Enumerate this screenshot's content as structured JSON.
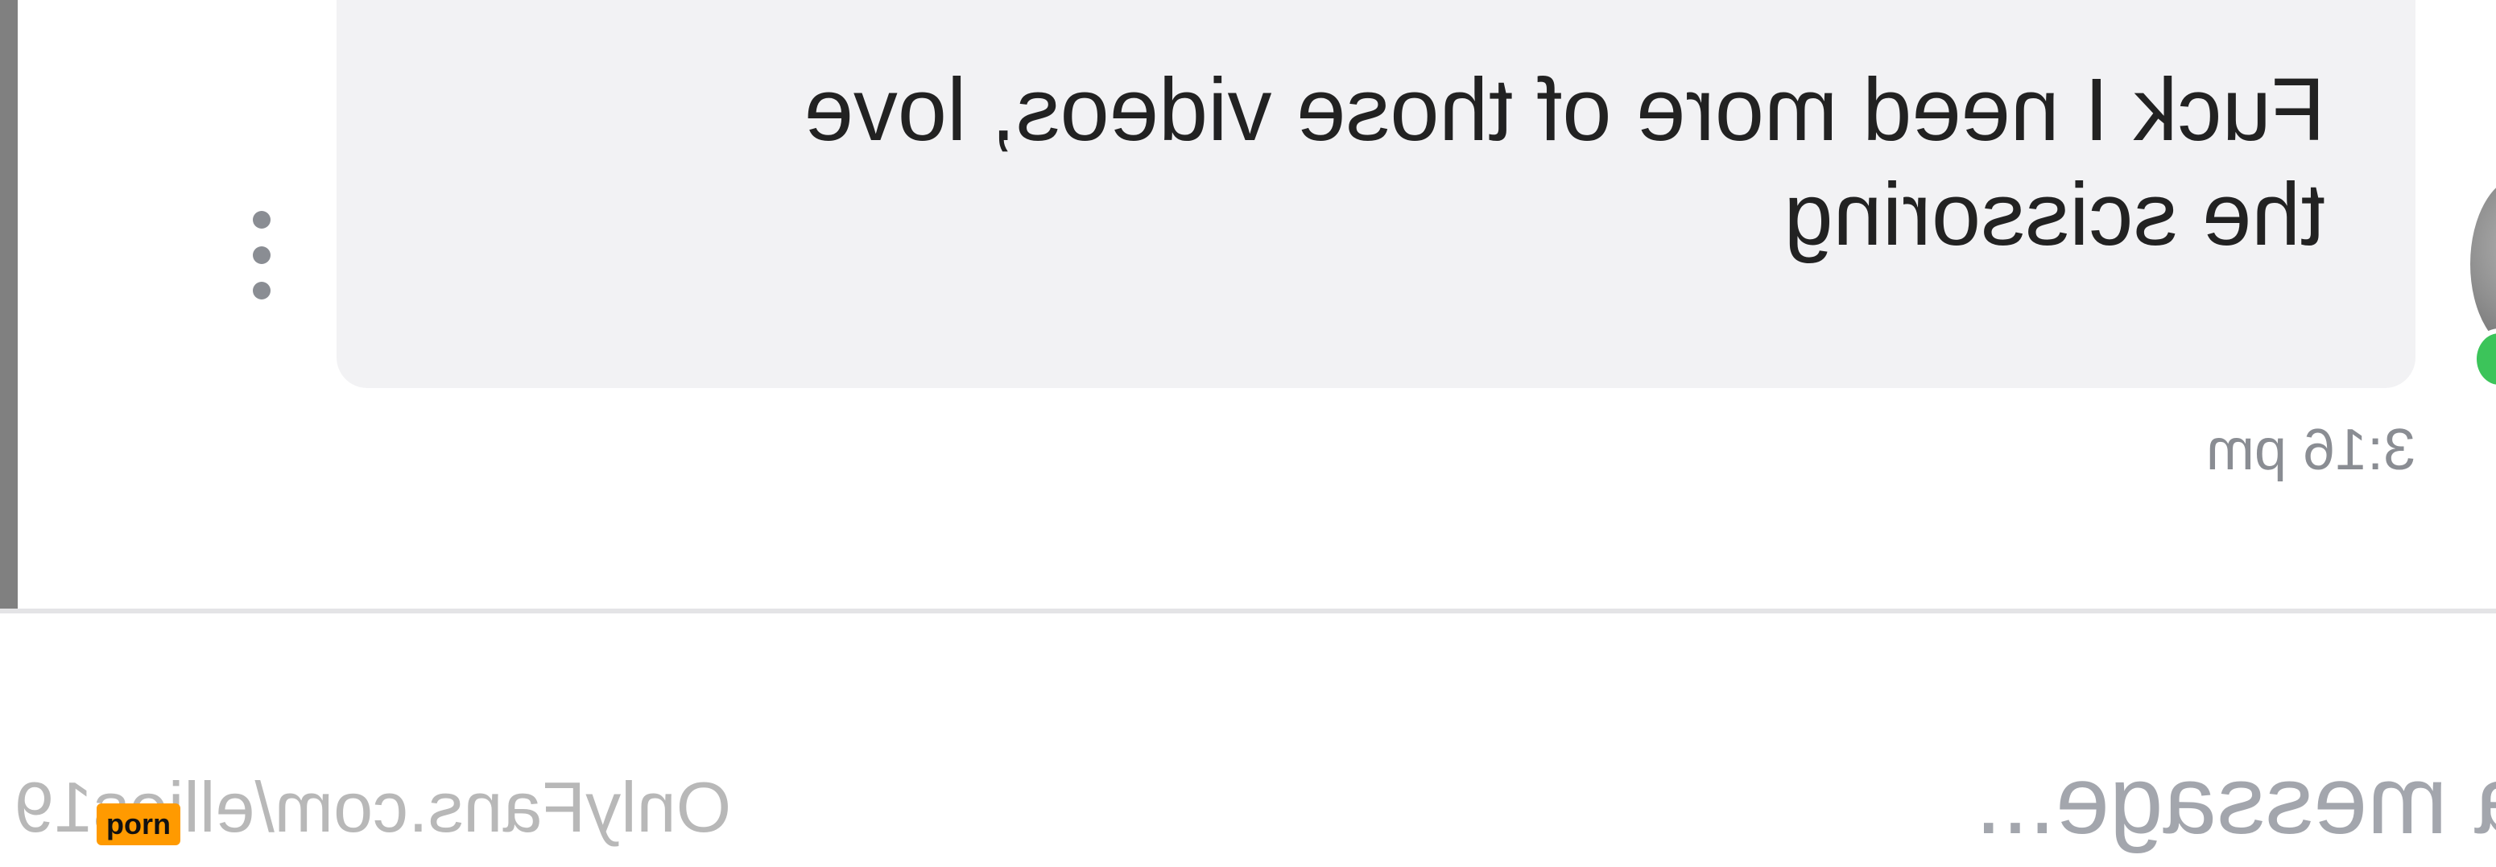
{
  "message": {
    "line1": "Fuck I need more of those videos, love",
    "line2": "the scissoring",
    "timestamp": "3:16 pm"
  },
  "composer": {
    "placeholder": "a message..."
  },
  "watermark": {
    "text": "OnlyFans.com/ellies19"
  },
  "badge": {
    "label": "porn"
  },
  "colors": {
    "bubble": "#f2f2f4",
    "online": "#3cc45a",
    "badge": "#ff9a00"
  },
  "icons": {
    "more": "more-vertical-icon"
  }
}
